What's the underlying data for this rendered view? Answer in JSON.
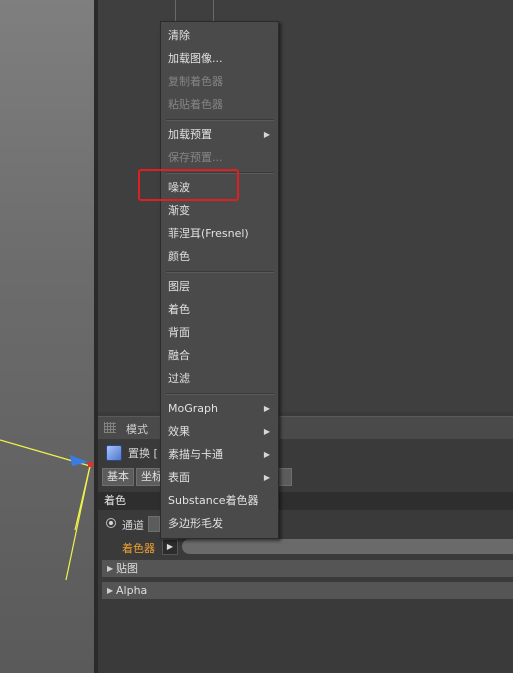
{
  "context_menu": {
    "items": [
      {
        "label": "清除",
        "disabled": false,
        "submenu": false
      },
      {
        "label": "加载图像...",
        "disabled": false,
        "submenu": false
      },
      {
        "label": "复制着色器",
        "disabled": true,
        "submenu": false
      },
      {
        "label": "粘贴着色器",
        "disabled": true,
        "submenu": false
      },
      {
        "label": "加载预置",
        "disabled": false,
        "submenu": true
      },
      {
        "label": "保存预置...",
        "disabled": true,
        "submenu": false
      },
      {
        "label": "噪波",
        "disabled": false,
        "submenu": false
      },
      {
        "label": "渐变",
        "disabled": false,
        "submenu": false
      },
      {
        "label": "菲涅耳(Fresnel)",
        "disabled": false,
        "submenu": false
      },
      {
        "label": "颜色",
        "disabled": false,
        "submenu": false
      },
      {
        "label": "图层",
        "disabled": false,
        "submenu": false
      },
      {
        "label": "着色",
        "disabled": false,
        "submenu": false
      },
      {
        "label": "背面",
        "disabled": false,
        "submenu": false
      },
      {
        "label": "融合",
        "disabled": false,
        "submenu": false
      },
      {
        "label": "过滤",
        "disabled": false,
        "submenu": false
      },
      {
        "label": "MoGraph",
        "disabled": false,
        "submenu": true
      },
      {
        "label": "效果",
        "disabled": false,
        "submenu": true
      },
      {
        "label": "素描与卡通",
        "disabled": false,
        "submenu": true
      },
      {
        "label": "表面",
        "disabled": false,
        "submenu": true
      },
      {
        "label": "Substance着色器",
        "disabled": false,
        "submenu": false
      },
      {
        "label": "多边形毛发",
        "disabled": false,
        "submenu": false
      }
    ]
  },
  "attribute_manager": {
    "mode_label": "模式",
    "object_name": "置换 [",
    "tabs": [
      "基本",
      "坐标"
    ],
    "section_title": "着色",
    "channel_label": "通道",
    "shader_label": "着色器",
    "fold_sections": [
      "贴图",
      "Alpha"
    ]
  },
  "colors": {
    "accent_orange": "#f0a030",
    "highlight_red": "#e02020"
  },
  "icons": {
    "submenu_arrow": "▶",
    "fold_triangle": "▶",
    "shader_arrow": "▶"
  }
}
